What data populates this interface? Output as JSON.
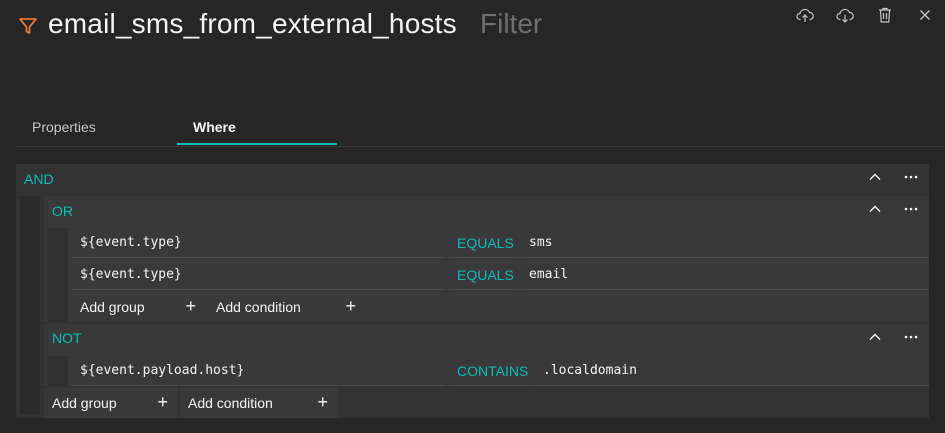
{
  "header": {
    "title": "email_sms_from_external_hosts",
    "type_label": "Filter",
    "icons": [
      "filter-icon",
      "upload-icon",
      "download-icon",
      "delete-icon",
      "close-icon"
    ]
  },
  "tabs": [
    {
      "label": "Properties",
      "selected": false
    },
    {
      "label": "Where",
      "selected": true
    }
  ],
  "where": {
    "root_operator": "AND",
    "or_group": {
      "operator": "OR",
      "conditions": [
        {
          "field": "${event.type}",
          "operator": "EQUALS",
          "value": "sms"
        },
        {
          "field": "${event.type}",
          "operator": "EQUALS",
          "value": "email"
        }
      ],
      "add_group_label": "Add group",
      "add_condition_label": "Add condition"
    },
    "not_group": {
      "operator": "NOT",
      "conditions": [
        {
          "field": "${event.payload.host}",
          "operator": "CONTAINS",
          "value": ".localdomain"
        }
      ]
    },
    "add_group_label": "Add group",
    "add_condition_label": "Add condition"
  },
  "colors": {
    "accent": "#08bdba",
    "filter_icon": "#ff832b",
    "background": "#262626"
  }
}
